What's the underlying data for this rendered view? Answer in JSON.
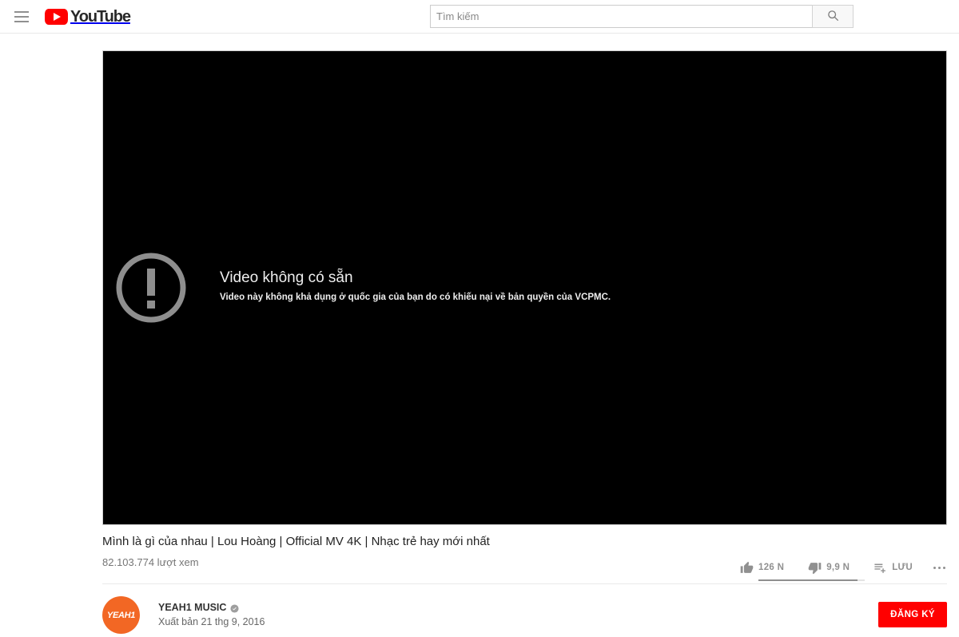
{
  "masthead": {
    "guide_toggle_name": "Menu",
    "logo_text": "YouTube",
    "search": {
      "placeholder": "Tìm kiếm",
      "value": "",
      "button_label": "Tìm kiếm"
    }
  },
  "player": {
    "error_title": "Video không có sẵn",
    "error_subtitle": "Video này không khả dụng ở quốc gia của bạn do có khiếu nại về bản quyền của VCPMC.",
    "background_color": "#000000"
  },
  "video": {
    "title": "Mình là gì của nhau | Lou Hoàng | Official MV 4K | Nhạc trẻ hay mới nhất",
    "views": "82.103.774 lượt xem"
  },
  "actions": {
    "like_count": "126 N",
    "dislike_count": "9,9 N",
    "save_label": "LƯU",
    "more_label": "...",
    "ratio_percent": 93
  },
  "channel": {
    "avatar_text": "YEAH1",
    "avatar_color": "#f26724",
    "name": "YEAH1 MUSIC",
    "verified": true,
    "published": "Xuất bản 21 thg 9, 2016",
    "subscribe_label": "ĐĂNG KÝ",
    "subscribe_color": "#ff0000"
  }
}
